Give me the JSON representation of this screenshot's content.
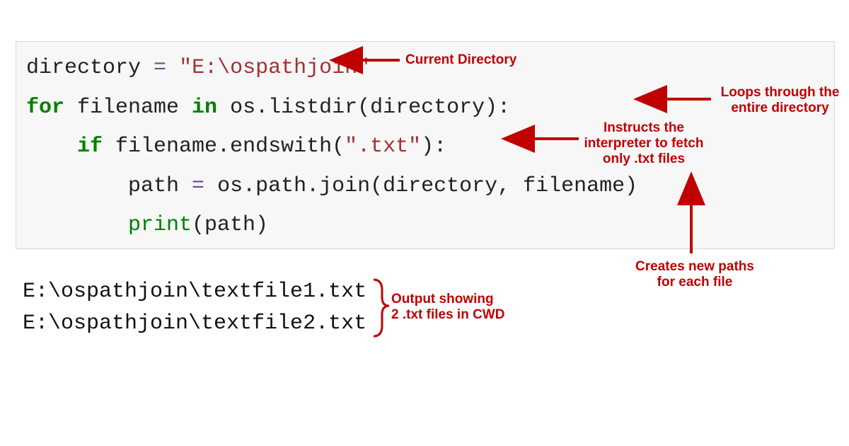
{
  "colors": {
    "annotation": "#c00000",
    "code_bg": "#f7f7f7",
    "keyword": "#008000",
    "string": "#a33132",
    "operator": "#6a4b94"
  },
  "code": {
    "l1_var": "directory ",
    "l1_eq": "=",
    "l1_sp": " ",
    "l1_str": "\"E:\\ospathjoin\"",
    "l2_for": "for",
    "l2_mid1": " filename ",
    "l2_in": "in",
    "l2_mid2": " os.listdir(directory):",
    "l3_indent": "    ",
    "l3_if": "if",
    "l3_rest": " filename.endswith(",
    "l3_str": "\".txt\"",
    "l3_close": "):",
    "l4_indent": "        ",
    "l4_body": "path ",
    "l4_eq": "=",
    "l4_rest": " os.path.join(directory, filename)",
    "l5_indent": "        ",
    "l5_print": "print",
    "l5_args": "(path)"
  },
  "output": {
    "line1": "E:\\ospathjoin\\textfile1.txt",
    "line2": "E:\\ospathjoin\\textfile2.txt"
  },
  "annotations": {
    "current_dir": "Current Directory",
    "loops": "Loops through the\nentire directory",
    "instructs": "Instructs the\ninterpreter to fetch\nonly .txt files",
    "creates": "Creates new paths\nfor each file",
    "output_note": "Output showing\n2 .txt files in CWD"
  }
}
